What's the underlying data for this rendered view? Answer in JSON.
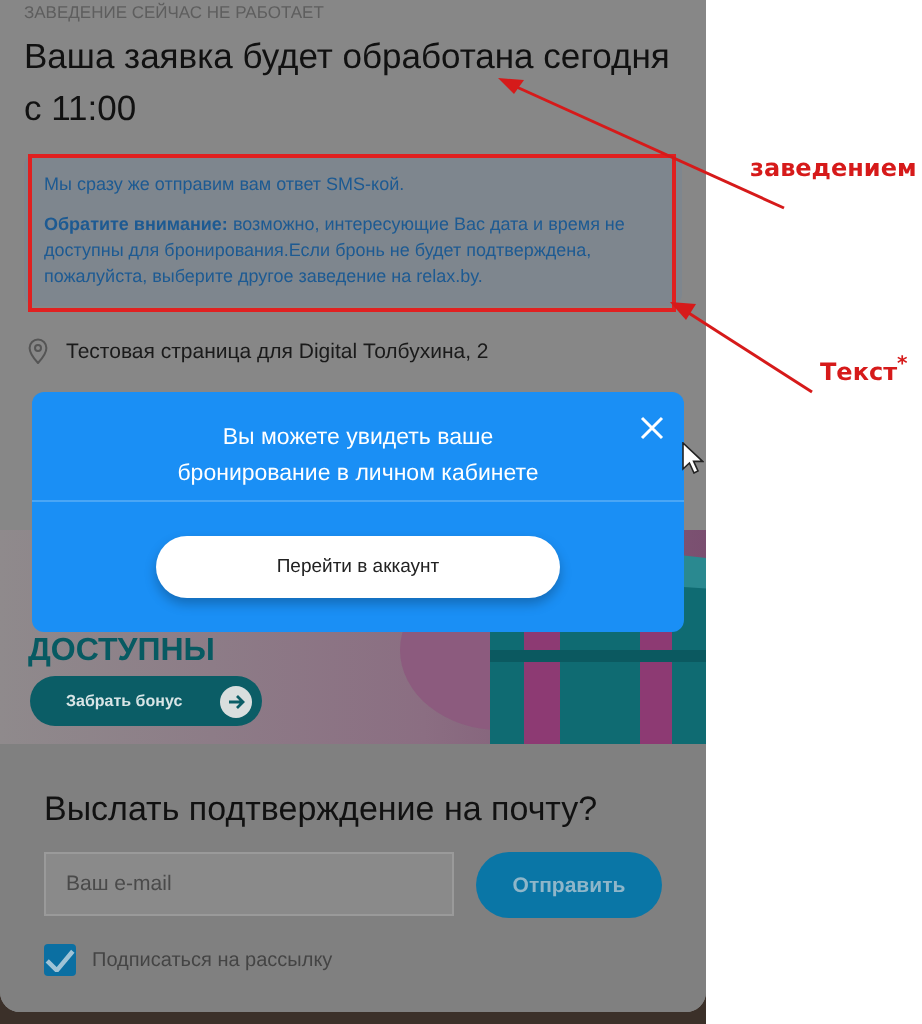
{
  "status_label": "ЗАВЕДЕНИЕ СЕЙЧАС НЕ РАБОТАЕТ",
  "title_lines": [
    "Ваша заявка будет обработана сегодня",
    "с 11:00"
  ],
  "notice": [
    "Мы сразу же отправим вам ответ SMS-кой.",
    "**Обратите внимание:** возможно, интересующие Вас дата и время не доступны для бронирования.Если бронь не будет подтверждена, пожалуйста, выберите другое заведение на relax.by."
  ],
  "address": "Тестовая страница для Digital Толбухина, 2",
  "banner": {
    "headline": "ДОСТУПНЫ",
    "button": "Забрать бонус"
  },
  "email_form": {
    "title": "Выслать подтверждение на почту?",
    "placeholder": "Ваш e-mail",
    "button": "Отправить",
    "subscribe": {
      "label": "Подписаться на рассылку",
      "checked": true
    }
  },
  "modal": {
    "message_lines": [
      "Вы можете увидеть ваше",
      "бронирование в личном кабинете"
    ],
    "button": "Перейти в аккаунт"
  },
  "annotations": [
    {
      "text": "заведением"
    },
    {
      "text": "Текст$^{*}$"
    }
  ]
}
